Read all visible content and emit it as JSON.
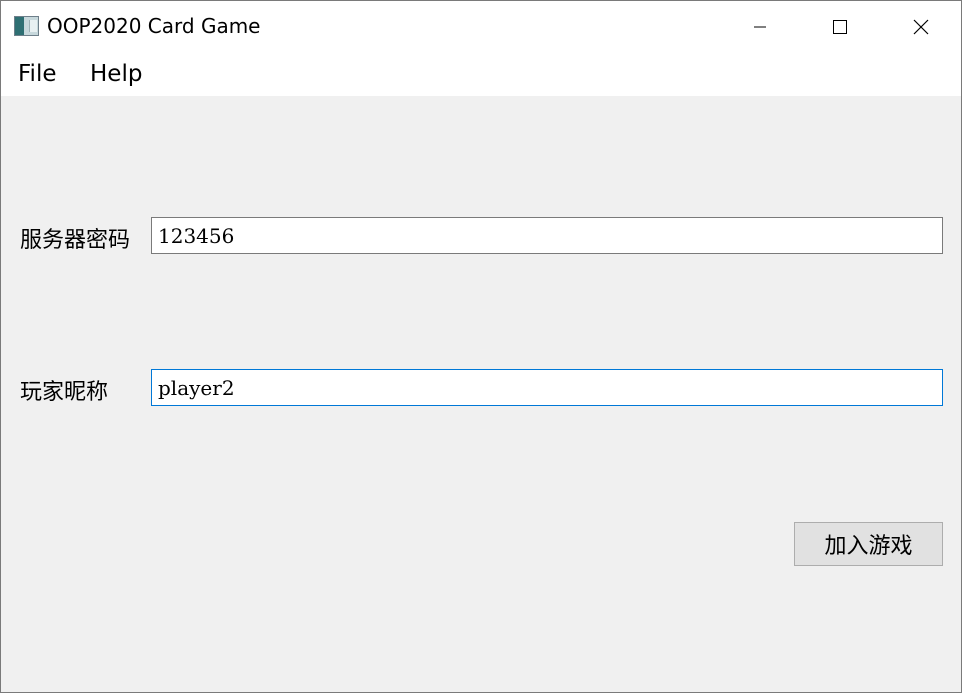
{
  "window": {
    "title": "OOP2020 Card Game",
    "icon": "app-icon",
    "controls": [
      "minimize-icon",
      "maximize-icon",
      "close-icon"
    ]
  },
  "menubar": {
    "items": [
      {
        "label": "File"
      },
      {
        "label": "Help"
      }
    ]
  },
  "form": {
    "server_password": {
      "label": "服务器密码",
      "value": "123456"
    },
    "nickname": {
      "label": "玩家昵称",
      "value": "player2",
      "focused": true
    },
    "join_button": {
      "label": "加入游戏"
    }
  },
  "colors": {
    "focus_border": "#0078d7",
    "content_bg": "#f0f0f0",
    "button_bg": "#e1e1e1"
  }
}
